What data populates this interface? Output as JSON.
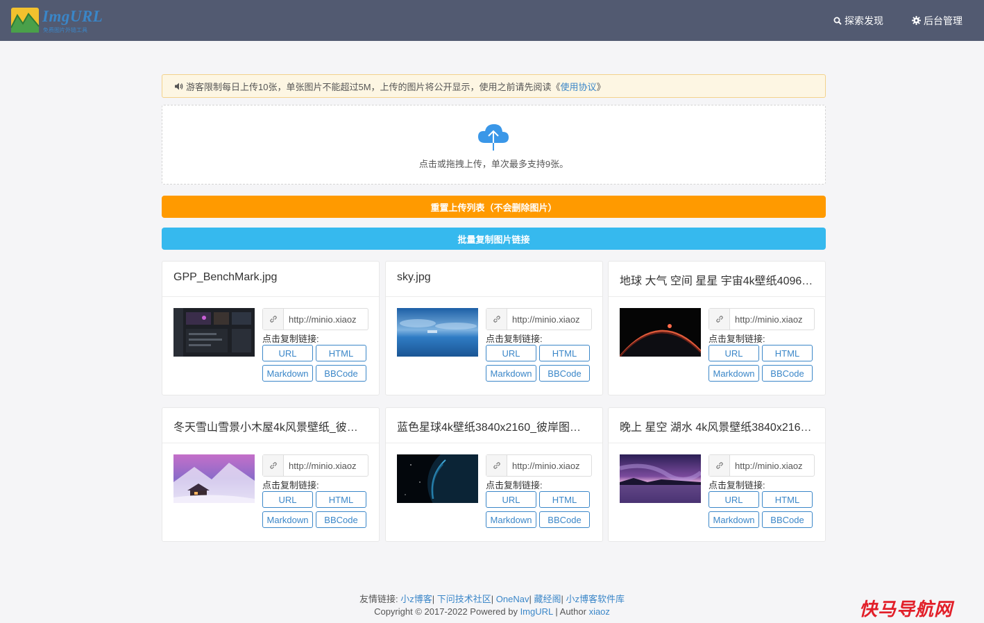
{
  "header": {
    "logo_text": "ImgURL",
    "logo_subtitle": "免费图片外链工具",
    "nav": [
      {
        "label": "探索发现",
        "icon": "search-icon"
      },
      {
        "label": "后台管理",
        "icon": "gear-icon"
      }
    ],
    "colors": {
      "bar": "#525a71",
      "accent": "#3a86c8"
    }
  },
  "notice": {
    "text": "游客限制每日上传10张，单张图片不能超过5M，上传的图片将公开显示，使用之前请先阅读《",
    "link": "使用协议",
    "suffix": "》",
    "icon": "speaker-icon"
  },
  "upload": {
    "hint": "点击或拖拽上传，单次最多支持9张。",
    "icon": "cloud-upload-icon"
  },
  "actions": {
    "reset_label": "重置上传列表（不会删除图片）",
    "copy_all_label": "批量复制图片链接",
    "reset_color": "#ff9a00",
    "copy_all_color": "#36b9ee"
  },
  "cards": [
    {
      "title": "GPP_BenchMark.jpg",
      "link": "http://minio.xiaoz",
      "thumb": "dark-dashboard"
    },
    {
      "title": "sky.jpg",
      "link": "http://minio.xiaoz",
      "thumb": "blue-sky"
    },
    {
      "title": "地球 大气 空间 星星 宇宙4k壁纸4096…",
      "link": "http://minio.xiaoz",
      "thumb": "earth-horizon"
    },
    {
      "title": "冬天雪山雪景小木屋4k风景壁纸_彼…",
      "link": "http://minio.xiaoz",
      "thumb": "snow-cabin"
    },
    {
      "title": "蓝色星球4k壁纸3840x2160_彼岸图…",
      "link": "http://minio.xiaoz",
      "thumb": "blue-planet"
    },
    {
      "title": "晚上 星空 湖水 4k风景壁纸3840x216…",
      "link": "http://minio.xiaoz",
      "thumb": "night-lake"
    }
  ],
  "card_labels": {
    "copy_label": "点击复制链接:",
    "url": "URL",
    "html": "HTML",
    "markdown": "Markdown",
    "bbcode": "BBCode"
  },
  "footer": {
    "links_prefix": "友情链接:",
    "links": [
      "小z博客",
      "下问技术社区",
      "OneNav",
      "藏经阁",
      "小z博客软件库"
    ],
    "copyright_prefix": "Copyright © 2017-2022 Powered by ",
    "powered_link": "ImgURL",
    "author_prefix": " | Author ",
    "author_link": "xiaoz"
  },
  "watermark": "快马导航网"
}
